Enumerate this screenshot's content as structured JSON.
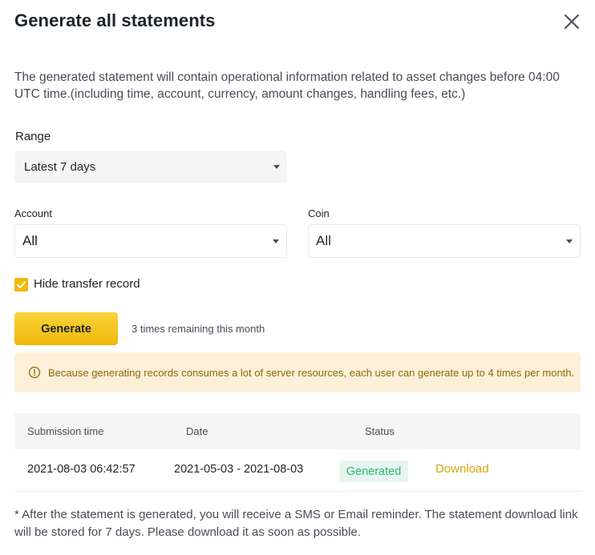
{
  "dialog": {
    "title": "Generate all statements",
    "close_icon": "close-icon"
  },
  "description": "The generated statement will contain operational information related to asset changes before 04:00 UTC time.(including time, account, currency, amount changes, handling fees, etc.)",
  "range": {
    "label": "Range",
    "selected": "Latest 7 days"
  },
  "account": {
    "label": "Account",
    "selected": "All"
  },
  "coin": {
    "label": "Coin",
    "selected": "All"
  },
  "hide_transfer": {
    "label": "Hide transfer record",
    "checked": true
  },
  "generate": {
    "button_label": "Generate",
    "remaining_text": "3 times remaining this month"
  },
  "notice": {
    "icon": "info-icon",
    "text": "Because generating records consumes a lot of server resources, each user can generate up to 4 times per month."
  },
  "table": {
    "headers": [
      "Submission time",
      "Date",
      "Status"
    ],
    "rows": [
      {
        "submission_time": "2021-08-03 06:42:57",
        "date": "2021-05-03 - 2021-08-03",
        "status": "Generated",
        "action": "Download"
      }
    ]
  },
  "footnote": "* After the statement is generated, you will receive a SMS or Email reminder. The statement download link will be stored for 7 days. Please download it as soon as possible.",
  "colors": {
    "accent": "#f0b90b",
    "notice_bg": "#fcf0d9",
    "status_green": "#2fb475",
    "link_gold": "#d9a50d"
  }
}
